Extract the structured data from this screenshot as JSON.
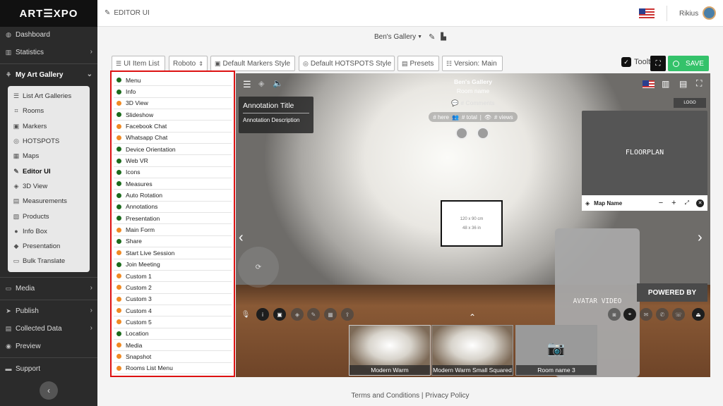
{
  "sidebar": {
    "logo": "ART☰XPO",
    "items": [
      {
        "label": "Dashboard",
        "icon": "dashboard-icon"
      },
      {
        "label": "Statistics",
        "icon": "chart-icon"
      },
      {
        "label": "My Art Gallery",
        "icon": "gallery-icon"
      }
    ],
    "submenu": [
      {
        "label": "List Art Galleries",
        "icon": "list-icon"
      },
      {
        "label": "Rooms",
        "icon": "room-icon"
      },
      {
        "label": "Markers",
        "icon": "marker-icon"
      },
      {
        "label": "HOTSPOTS",
        "icon": "hotspot-icon"
      },
      {
        "label": "Maps",
        "icon": "map-icon"
      },
      {
        "label": "Editor UI",
        "icon": "editor-icon"
      },
      {
        "label": "3D View",
        "icon": "cube-icon"
      },
      {
        "label": "Measurements",
        "icon": "ruler-icon"
      },
      {
        "label": "Products",
        "icon": "product-icon"
      },
      {
        "label": "Info Box",
        "icon": "info-icon"
      },
      {
        "label": "Presentation",
        "icon": "presentation-icon"
      },
      {
        "label": "Bulk Translate",
        "icon": "translate-icon"
      }
    ],
    "bottom_items": [
      {
        "label": "Media",
        "icon": "media-icon"
      },
      {
        "label": "Publish",
        "icon": "publish-icon"
      },
      {
        "label": "Collected Data",
        "icon": "data-icon"
      },
      {
        "label": "Preview",
        "icon": "eye-icon"
      },
      {
        "label": "Support",
        "icon": "support-icon"
      }
    ]
  },
  "topbar": {
    "title": "EDITOR UI",
    "user": "Rikius"
  },
  "gallery": {
    "name": "Ben's Gallery"
  },
  "toolbar": {
    "ui_item_list": "UI Item List",
    "font": "Roboto",
    "markers_style": "Default Markers Style",
    "hotspots_style": "Default HOTSPOTS Style",
    "presets": "Presets",
    "version": "Version: Main",
    "tooltips": "Tooltips",
    "save": "SAVE"
  },
  "ui_items": [
    {
      "label": "Menu",
      "status": "green"
    },
    {
      "label": "Info",
      "status": "green"
    },
    {
      "label": "3D View",
      "status": "orange"
    },
    {
      "label": "Slideshow",
      "status": "green"
    },
    {
      "label": "Facebook Chat",
      "status": "orange"
    },
    {
      "label": "Whatsapp Chat",
      "status": "orange"
    },
    {
      "label": "Device Orientation",
      "status": "green"
    },
    {
      "label": "Web VR",
      "status": "green"
    },
    {
      "label": "Icons",
      "status": "green"
    },
    {
      "label": "Measures",
      "status": "green"
    },
    {
      "label": "Auto Rotation",
      "status": "green"
    },
    {
      "label": "Annotations",
      "status": "green"
    },
    {
      "label": "Presentation",
      "status": "green"
    },
    {
      "label": "Main Form",
      "status": "orange"
    },
    {
      "label": "Share",
      "status": "green"
    },
    {
      "label": "Start Live Session",
      "status": "orange"
    },
    {
      "label": "Join Meeting",
      "status": "green"
    },
    {
      "label": "Custom 1",
      "status": "orange"
    },
    {
      "label": "Custom 2",
      "status": "orange"
    },
    {
      "label": "Custom 3",
      "status": "orange"
    },
    {
      "label": "Custom 4",
      "status": "orange"
    },
    {
      "label": "Custom 5",
      "status": "orange"
    },
    {
      "label": "Location",
      "status": "green"
    },
    {
      "label": "Media",
      "status": "orange"
    },
    {
      "label": "Snapshot",
      "status": "orange"
    },
    {
      "label": "Rooms List Menu",
      "status": "orange"
    }
  ],
  "viewer": {
    "gallery_name": "Ben's Gallery",
    "room_name": "Room name",
    "comments": "# Comments",
    "here": "# here",
    "total": "# total",
    "views": "# views",
    "annotation_title": "Annotation Title",
    "annotation_description": "Annotation Description",
    "logo": "LOGO",
    "floorplan": "FLOORPLAN",
    "map_name": "Map Name",
    "artwork_cm": "120 x 90 cm",
    "artwork_in": "48 x 36 in",
    "avatar_video": "AVATAR VIDEO",
    "powered_by": "POWERED BY",
    "rooms": [
      {
        "name": "Modern Warm"
      },
      {
        "name": "Modern Warm Small Squared"
      },
      {
        "name": "Room name 3"
      }
    ]
  },
  "footer": {
    "terms": "Terms and Conditions",
    "privacy": "Privacy Policy"
  },
  "colors": {
    "green": "#1d6b1d",
    "orange": "#f08a24",
    "save": "#34c26a",
    "highlight": "#d11111"
  }
}
